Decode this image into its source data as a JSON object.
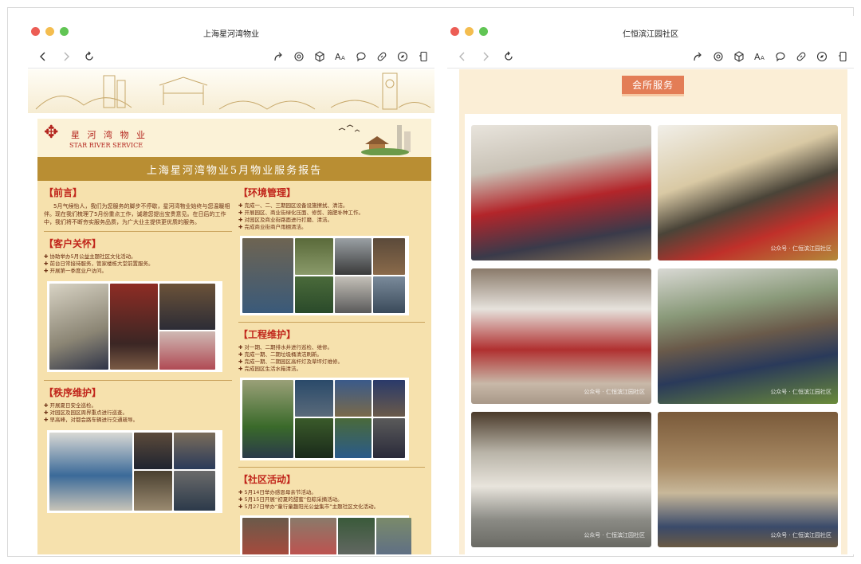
{
  "left_window": {
    "title": "上海星河湾物业",
    "poster": {
      "logo_cn": "星 河 湾 物 业",
      "logo_en": "STAR RIVER SERVICE",
      "main_title": "上海星河湾物业5月物业服务报告",
      "sections": {
        "preface": {
          "heading": "【前言】",
          "text": "5月气候怡人，我们为您服务的脚步不停歇，星河湾物业始终与您温暖相伴。现在我们梳理了5月份重点工作，诚邀您提出宝贵意见。在日后的工作中，我们将不断夯实服务品质，为广大业主提供更优质的服务。"
        },
        "care": {
          "heading": "【客户关怀】",
          "items": [
            "协助举办5月公益主题社区文化活动。",
            "前台日常接待服务，管家楼栋大堂前置服务。",
            "开展第一季度业户访问。"
          ]
        },
        "order": {
          "heading": "【秩序维护】",
          "items": [
            "开展夏日安全巡检。",
            "对园区及园区周界重点进行巡查。",
            "早高峰，对都会路车辆进行交通疏导。"
          ]
        },
        "environment": {
          "heading": "【环境管理】",
          "items": [
            "完成一、二、三期园区设备设施擦拭、清洁。",
            "开展园区、商业街绿化压面、修剪、施肥补种工作。",
            "对园区及商业街路面进行打磨、清洁。",
            "完成商业街商户雨棚清洁。"
          ]
        },
        "engineering": {
          "heading": "【工程维护】",
          "items": [
            "对一期、二期排水井进行巡检、维修。",
            "完成一期、二期垃圾桶清洁刷新。",
            "完成一期、二期园区高杆灯及草坪灯维修。",
            "完成园区生活水箱清洁。"
          ]
        },
        "community": {
          "heading": "【社区活动】",
          "items": [
            "5月14日举办感恩母亲节活动。",
            "5月15日开展“初夏的甜蜜”包粽采摘活动。",
            "5月27日举办“童行童趣阳光公益集市”主题社区文化活动。"
          ]
        }
      }
    }
  },
  "right_window": {
    "title": "仁恒滨江园社区",
    "section_badge": "会所服务",
    "watermark": "公众号 · 仁恒滨江园社区"
  },
  "toolbar": {
    "icons": [
      "back-icon",
      "forward-icon",
      "reload-icon",
      "share-icon",
      "settings-icon",
      "package-icon",
      "font-size-icon",
      "comment-icon",
      "link-icon",
      "compass-icon",
      "mobile-icon"
    ]
  },
  "colors": {
    "poster_bg": "#f6e1ad",
    "poster_title_band": "#b98e33",
    "heading_red": "#c0241a",
    "badge": "#e37d56",
    "right_bg": "#fbeed6"
  }
}
